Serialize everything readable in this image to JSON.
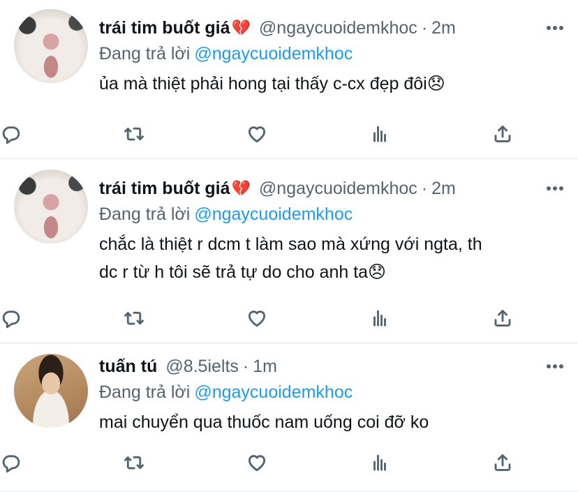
{
  "tweets": [
    {
      "author_name": "trái tim buốt giá",
      "author_emoji": "💔",
      "handle": "@ngaycuoidemkhoc",
      "time": "2m",
      "replying_label": "Đang trả lời",
      "replying_to": "@ngaycuoidemkhoc",
      "text": "ủa mà thiệt phải hong tại thấy c-cx đẹp đôi😞",
      "avatar": "cat-avatar"
    },
    {
      "author_name": "trái tim buốt giá",
      "author_emoji": "💔",
      "handle": "@ngaycuoidemkhoc",
      "time": "2m",
      "replying_label": "Đang trả lời",
      "replying_to": "@ngaycuoidemkhoc",
      "text": "chắc là thiệt r dcm t làm sao mà xứng với ngta, th\ndc r từ h tôi sẽ trả tự do cho anh ta😞",
      "avatar": "cat-avatar"
    },
    {
      "author_name": "tuấn tú",
      "author_emoji": "",
      "handle": "@8.5ielts",
      "time": "1m",
      "replying_label": "Đang trả lời",
      "replying_to": "@ngaycuoidemkhoc",
      "text": "mai chuyển qua thuốc nam uống coi đỡ ko",
      "avatar": "boy-avatar"
    }
  ],
  "header_separator": "·",
  "action_icons": [
    "reply-icon",
    "retweet-icon",
    "like-icon",
    "analytics-icon",
    "share-icon"
  ],
  "colors": {
    "link": "#1d9bf0",
    "secondary_text": "#536471",
    "primary_text": "#0f1419",
    "divider": "#e1e8ed"
  }
}
